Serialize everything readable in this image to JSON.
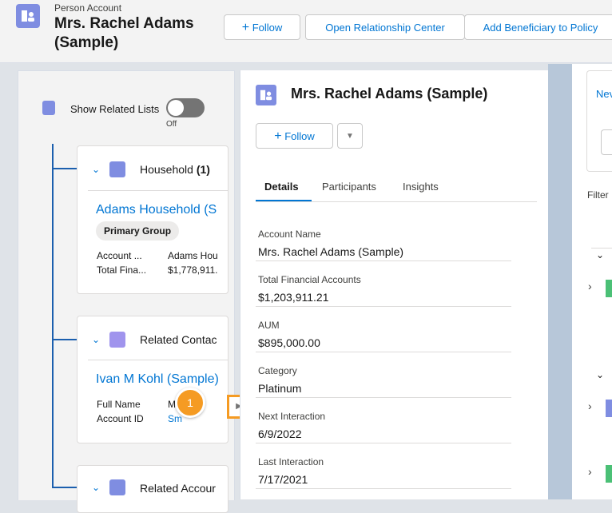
{
  "header": {
    "object_type": "Person Account",
    "record_name": "Mrs. Rachel Adams (Sample)",
    "actions": {
      "follow": "Follow",
      "open_relationship_center": "Open Relationship Center",
      "add_beneficiary": "Add Beneficiary to Policy"
    }
  },
  "left_panel": {
    "show_related_lists_label": "Show Related Lists",
    "toggle_state": "Off",
    "household": {
      "title": "Household",
      "count": "(1)",
      "record_link": "Adams Household (S",
      "badge": "Primary Group",
      "rows": [
        {
          "label": "Account ...",
          "value": "Adams Hou"
        },
        {
          "label": "Total Fina...",
          "value": "$1,778,911."
        }
      ]
    },
    "related_contacts": {
      "title": "Related Contac",
      "record_link": "Ivan M Kohl (Sample)",
      "rows": [
        {
          "label": "Full Name",
          "value": "Mr"
        },
        {
          "label": "Account ID",
          "value": "Sm"
        }
      ]
    },
    "related_accounts": {
      "title": "Related Accour"
    }
  },
  "center_panel": {
    "title": "Mrs. Rachel Adams (Sample)",
    "follow_label": "Follow",
    "tabs": [
      "Details",
      "Participants",
      "Insights"
    ],
    "active_tab": "Details",
    "fields": [
      {
        "label": "Account Name",
        "value": "Mrs. Rachel Adams (Sample)"
      },
      {
        "label": "Total Financial Accounts",
        "value": "$1,203,911.21"
      },
      {
        "label": "AUM",
        "value": "$895,000.00"
      },
      {
        "label": "Category",
        "value": "Platinum"
      },
      {
        "label": "Next Interaction",
        "value": "6/9/2022"
      },
      {
        "label": "Last Interaction",
        "value": "7/17/2021"
      }
    ]
  },
  "right_panel": {
    "new_label": "Nev",
    "filter_label": "Filter"
  },
  "callout": {
    "number": "1"
  },
  "colors": {
    "brand_blue": "#0176d3",
    "account_icon": "#7f8de1",
    "callout_orange": "#f59b23",
    "tree_line": "#1b5fae"
  }
}
